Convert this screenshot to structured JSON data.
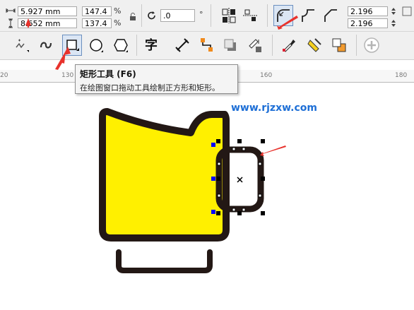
{
  "property_bar": {
    "width_value": "5.927 mm",
    "height_value": "8.652 mm",
    "scale_x": "147.4",
    "scale_y": "137.4",
    "percent_symbol": "%",
    "rotation_value": ".0",
    "degree_symbol": "°",
    "corner_radius_top": "2.196 mm",
    "corner_radius_bottom": "2.196 mm"
  },
  "toolbar": {
    "text_tool_glyph": "字",
    "add_tool_glyph": "+"
  },
  "ruler": {
    "labels": [
      "20",
      "130",
      "160",
      "180"
    ]
  },
  "tooltip": {
    "title": "矩形工具 (F6)",
    "description": "在绘图窗口拖动工具绘制正方形和矩形。"
  },
  "watermark": {
    "text": "www.rjzxw.com"
  },
  "colors": {
    "cup_fill": "#fff000",
    "outline": "#231815",
    "node_blue": "#0000ff",
    "arrow_red": "#e8322c",
    "watermark_blue": "#1e6fd6"
  }
}
